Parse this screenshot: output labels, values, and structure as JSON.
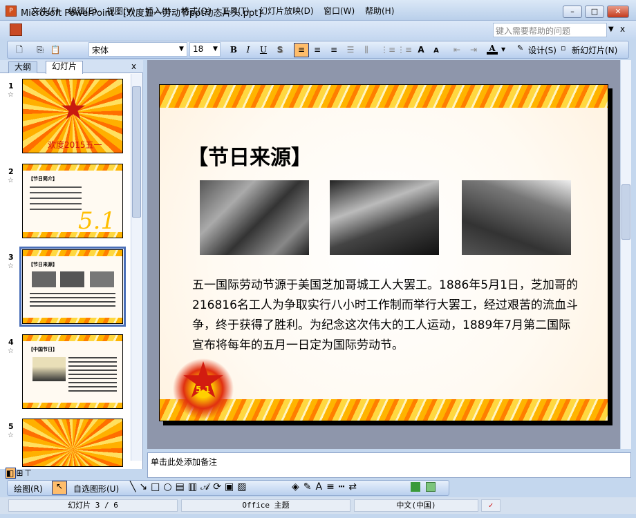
{
  "window": {
    "title": "Microsoft PowerPoint - [欢度五一劳动节ppt动态片头.ppt]",
    "app_icon": "P"
  },
  "menu": [
    "文件(F)",
    "编辑(E)",
    "视图(V)",
    "插入(I)",
    "格式(O)",
    "工具(T)",
    "幻灯片放映(D)",
    "窗口(W)",
    "帮助(H)"
  ],
  "help_placeholder": "键入需要帮助的问题",
  "toolbar": {
    "font": "宋体",
    "size": "18",
    "bold": "B",
    "italic": "I",
    "underline": "U",
    "shadow": "S",
    "grow": "A",
    "shrink": "A",
    "font_color": "A",
    "design": "设计(S)",
    "new_slide": "新幻灯片(N)"
  },
  "panel": {
    "tabs": [
      "大纲",
      "幻灯片"
    ],
    "close": "x"
  },
  "thumbnails": [
    {
      "num": "1",
      "text": "欢度2015五一"
    },
    {
      "num": "2",
      "title": "【节日简介】",
      "big": "5.1"
    },
    {
      "num": "3",
      "title": "【节日来源】"
    },
    {
      "num": "4",
      "title": "【中国节日】"
    },
    {
      "num": "5"
    }
  ],
  "slide": {
    "title": "【节日来源】",
    "badge": "5.1",
    "body": "五一国际劳动节源于美国芝加哥城工人大罢工。1886年5月1日，芝加哥的216816名工人为争取实行八小时工作制而举行大罢工，经过艰苦的流血斗争，终于获得了胜利。为纪念这次伟大的工人运动，1889年7月第二国际宣布将每年的五月一日定为国际劳动节。"
  },
  "notes_placeholder": "单击此处添加备注",
  "drawing": {
    "draw": "绘图(R)",
    "autoshapes": "自选图形(U)"
  },
  "status": {
    "slide": "幻灯片 3 / 6",
    "theme": "Office 主题",
    "lang": "中文(中国)"
  }
}
